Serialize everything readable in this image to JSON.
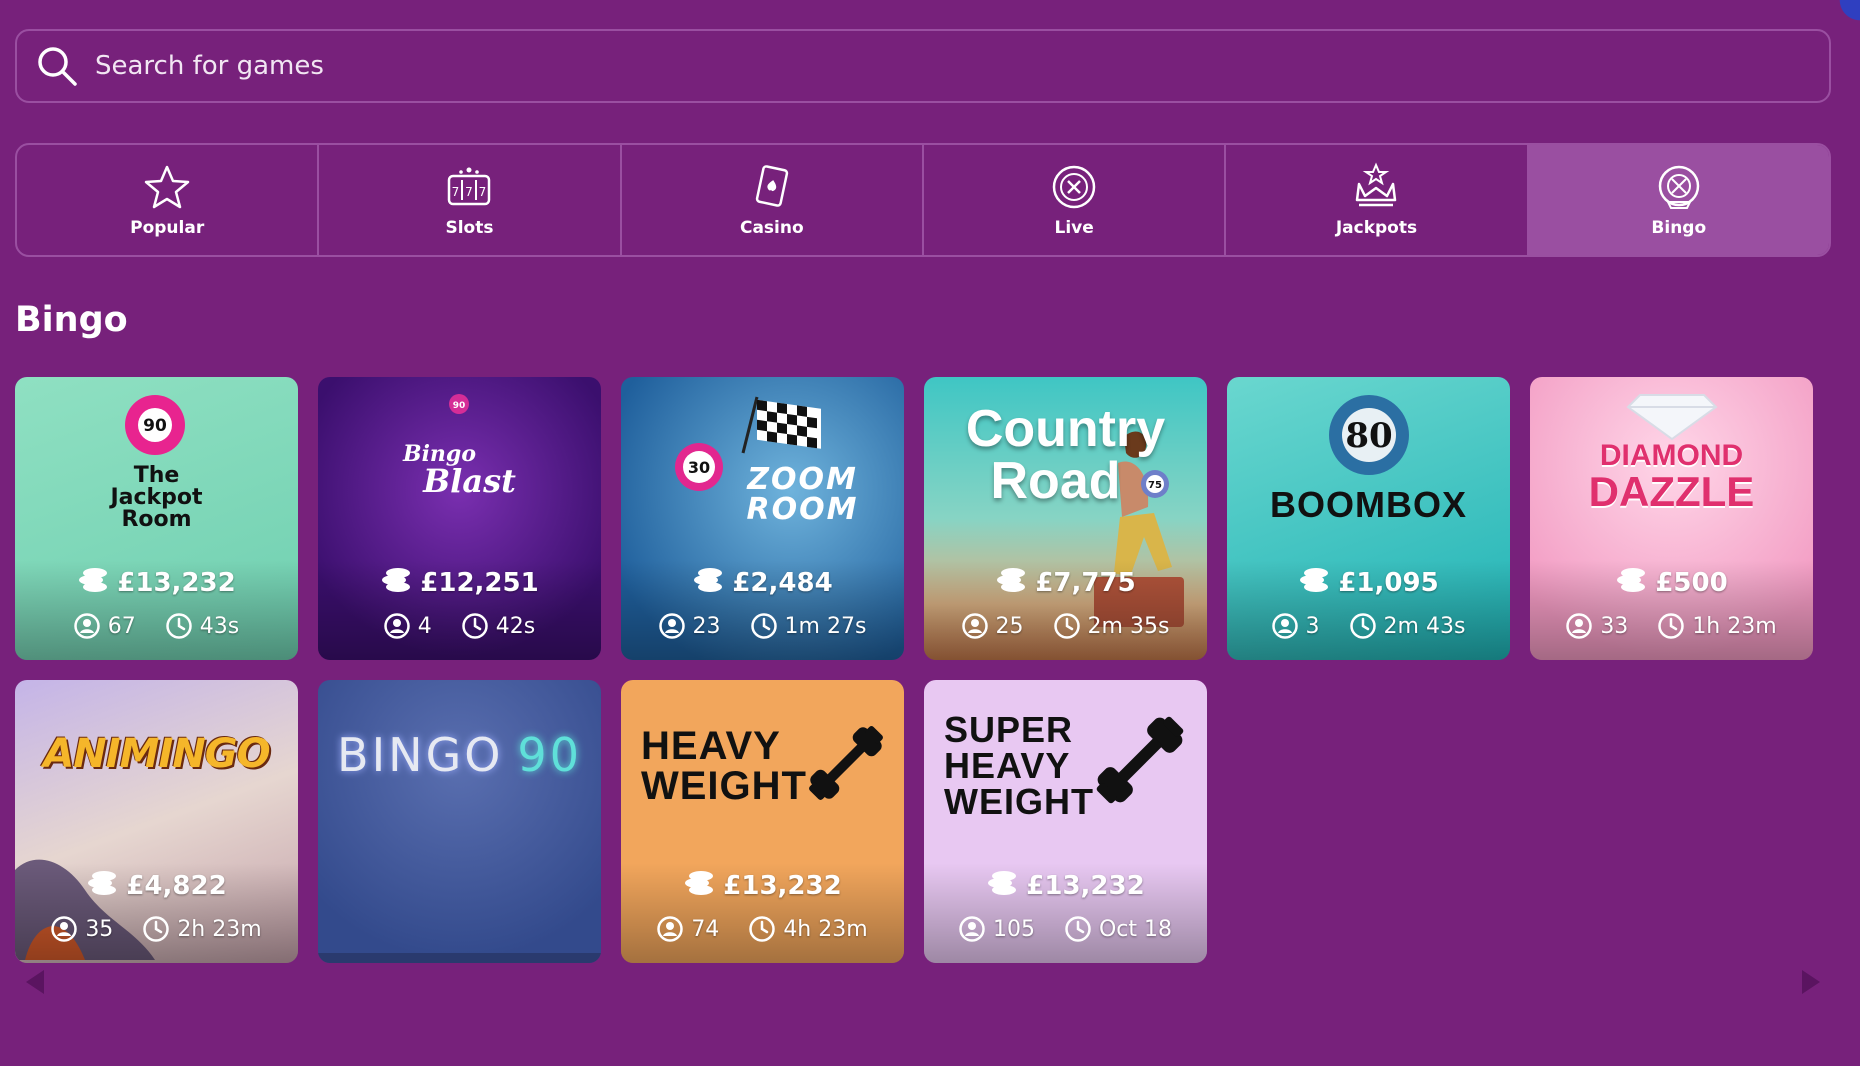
{
  "search": {
    "placeholder": "Search for games"
  },
  "categories": [
    {
      "label": "Popular",
      "icon": "star-icon"
    },
    {
      "label": "Slots",
      "icon": "slot-machine-icon"
    },
    {
      "label": "Casino",
      "icon": "playing-card-icon"
    },
    {
      "label": "Live",
      "icon": "roulette-icon"
    },
    {
      "label": "Jackpots",
      "icon": "crown-icon"
    },
    {
      "label": "Bingo",
      "icon": "bingo-ball-icon",
      "active": true
    }
  ],
  "section": {
    "title": "Bingo"
  },
  "games": [
    {
      "title_lines": [
        "The",
        "Jackpot",
        "Room"
      ],
      "ball": "90",
      "jackpot": "£13,232",
      "players": "67",
      "time": "43s"
    },
    {
      "title_lines": [
        "Bingo",
        "Blast"
      ],
      "ball": "90",
      "jackpot": "£12,251",
      "players": "4",
      "time": "42s"
    },
    {
      "title_lines": [
        "ZOOM",
        "ROOM"
      ],
      "ball": "30",
      "jackpot": "£2,484",
      "players": "23",
      "time": "1m 27s"
    },
    {
      "title_lines": [
        "Country",
        "Road"
      ],
      "ball": "75",
      "jackpot": "£7,775",
      "players": "25",
      "time": "2m 35s"
    },
    {
      "title_lines": [
        "BOOMBOX"
      ],
      "ball": "80",
      "jackpot": "£1,095",
      "players": "3",
      "time": "2m 43s"
    },
    {
      "title_lines": [
        "DIAMOND",
        "DAZZLE"
      ],
      "jackpot": "£500",
      "players": "33",
      "time": "1h 23m"
    },
    {
      "title_lines": [
        "ANIMINGO"
      ],
      "jackpot": "£4,822",
      "players": "35",
      "time": "2h 23m"
    },
    {
      "title_lines": [
        "BINGO",
        "90"
      ]
    },
    {
      "title_lines": [
        "HEAVY",
        "WEIGHT"
      ],
      "jackpot": "£13,232",
      "players": "74",
      "time": "4h 23m"
    },
    {
      "title_lines": [
        "SUPER",
        "HEAVY",
        "WEIGHT"
      ],
      "jackpot": "£13,232",
      "players": "105",
      "time": "Oct 18"
    }
  ],
  "colors": {
    "background": "#77217b",
    "border": "#9a4fa1",
    "active_tab": "#9a4fa1"
  }
}
